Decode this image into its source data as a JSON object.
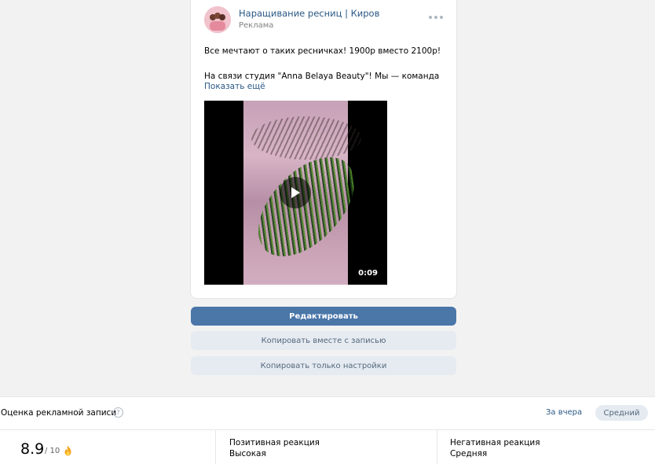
{
  "post": {
    "author": "Наращивание ресниц | Киров",
    "ad_label": "Реклама",
    "text_line1": "Все мечтают о таких ресничках! 1900р вместо 2100р!",
    "text_line2": "На связи студия \"Anna Belaya Beauty\"! Мы — команда",
    "show_more": "Показать ещё",
    "video": {
      "duration": "0:09",
      "play_icon": "play-icon"
    },
    "more_icon": "more-horizontal-icon"
  },
  "actions": {
    "edit": "Редактировать",
    "copy_with_post": "Копировать вместе с записью",
    "copy_settings_only": "Копировать только настройки"
  },
  "rating": {
    "title": "Оценка рекламной записи",
    "help_icon": "?",
    "period": "За вчера",
    "level": "Средний",
    "score": "8.9",
    "score_max": "/ 10",
    "score_icon": "fire-icon",
    "positive_label": "Позитивная реакция",
    "positive_value": "Высокая",
    "negative_label": "Негативная реакция",
    "negative_value": "Средняя"
  },
  "colors": {
    "link": "#2a5885",
    "primary_button": "#4a76a8",
    "secondary_button": "#e5ebf1"
  }
}
